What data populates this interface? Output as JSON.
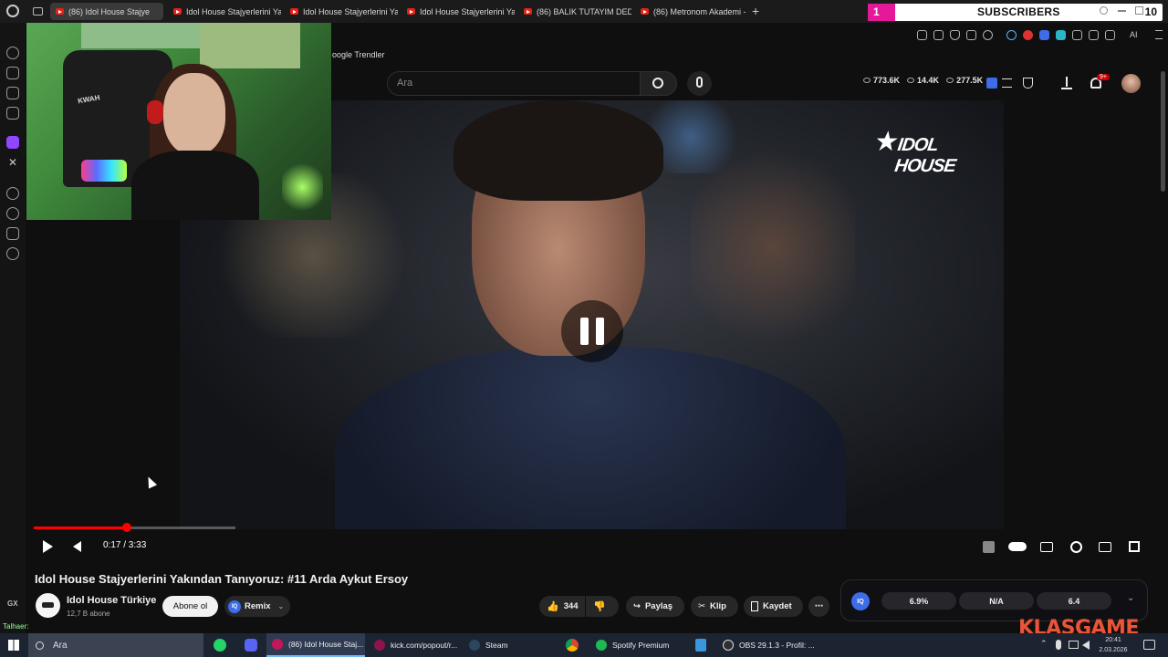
{
  "browser": {
    "tabs": [
      {
        "label": "(86) Idol House Stajye",
        "active": true
      },
      {
        "label": "Idol House Stajyerlerini Ya",
        "active": false
      },
      {
        "label": "Idol House Stajyerlerini Ya",
        "active": false
      },
      {
        "label": "Idol House Stajyerlerini Ya",
        "active": false
      },
      {
        "label": "(86) BALIK TUTAYIM DED",
        "active": false
      },
      {
        "label": "(86) Metronom Akademi -",
        "active": false
      }
    ],
    "new_tab": "+",
    "bookmark": "oogle Trendler",
    "ai_label": "AI"
  },
  "subs_widget": {
    "count": "1",
    "label": "SUBSCRIBERS",
    "goal": "10"
  },
  "youtube_header": {
    "search_placeholder": "Ara",
    "stats": [
      "773.6K",
      "14.4K",
      "277.5K"
    ],
    "notification_badge": "9+"
  },
  "video": {
    "logo_text": "IDOL HOUSE",
    "time": "0:17 / 3:33",
    "progress": 0.46,
    "title": "Idol House Stajyerlerini Yakından Tanıyoruz: #11 Arda Aykut Ersoy"
  },
  "channel": {
    "name": "Idol House Türkiye",
    "subs": "12,7 B abone",
    "subscribe_label": "Abone ol",
    "remix_label": "Remix"
  },
  "actions": {
    "like_count": "344",
    "share_label": "Paylaş",
    "clip_label": "Klip",
    "save_label": "Kaydet"
  },
  "iq_panel": {
    "logo": "IQ",
    "stats": [
      "6.9%",
      "N/A",
      "6.4"
    ]
  },
  "sidebar": {
    "gx": "GX"
  },
  "chat": {
    "line": "Talhaer: "
  },
  "taskbar": {
    "search": "Ara",
    "items": [
      {
        "label": "(86) Idol House Staj...",
        "active": true
      },
      {
        "label": "kick.com/popout/r...",
        "active": false
      },
      {
        "label": "Steam",
        "active": false
      },
      {
        "label": "Spotify Premium",
        "active": false
      },
      {
        "label": "OBS 29.1.3 - Profil: ...",
        "active": false
      }
    ],
    "time": "20:41",
    "date": "2.03.2026"
  },
  "overlay": {
    "brand": "KLASGAME"
  },
  "colors": {
    "accent": "#ff0000",
    "subs_pink": "#e5189a",
    "iq_blue": "#3d6ce8",
    "klasgame": "#e8553a"
  }
}
